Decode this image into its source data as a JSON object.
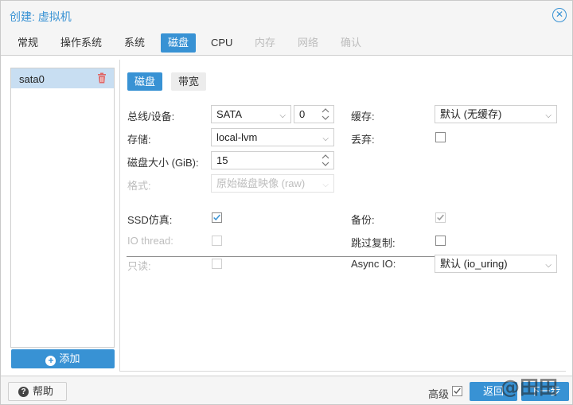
{
  "dialog": {
    "title": "创建: 虚拟机"
  },
  "tabs": [
    {
      "label": "常规",
      "state": "normal"
    },
    {
      "label": "操作系统",
      "state": "normal"
    },
    {
      "label": "系统",
      "state": "normal"
    },
    {
      "label": "磁盘",
      "state": "active"
    },
    {
      "label": "CPU",
      "state": "normal"
    },
    {
      "label": "内存",
      "state": "disabled"
    },
    {
      "label": "网络",
      "state": "disabled"
    },
    {
      "label": "确认",
      "state": "disabled"
    }
  ],
  "disk_list": {
    "items": [
      {
        "label": "sata0",
        "selected": true
      }
    ],
    "add_label": "添加"
  },
  "subtabs": [
    {
      "label": "磁盘",
      "active": true
    },
    {
      "label": "带宽",
      "active": false
    }
  ],
  "form": {
    "bus_device": {
      "label": "总线/设备:",
      "bus": "SATA",
      "device": "0"
    },
    "storage": {
      "label": "存储:",
      "value": "local-lvm"
    },
    "disk_size": {
      "label": "磁盘大小 (GiB):",
      "value": "15"
    },
    "format": {
      "label": "格式:",
      "value": "原始磁盘映像 (raw)",
      "disabled": true
    },
    "cache": {
      "label": "缓存:",
      "value": "默认 (无缓存)"
    },
    "discard": {
      "label": "丢弃:",
      "checked": false
    },
    "ssd_emulation": {
      "label": "SSD仿真:",
      "checked": true
    },
    "io_thread": {
      "label": "IO thread:",
      "checked": false,
      "disabled": true
    },
    "readonly": {
      "label": "只读:",
      "checked": false,
      "disabled": true
    },
    "backup": {
      "label": "备份:",
      "checked": true,
      "disabled": true
    },
    "skip_replication": {
      "label": "跳过复制:",
      "checked": false
    },
    "async_io": {
      "label": "Async IO:",
      "value": "默认 (io_uring)"
    }
  },
  "footer": {
    "help_label": "帮助",
    "advanced_label": "高级",
    "advanced_checked": true,
    "back_label": "返回",
    "next_label": "下一步"
  },
  "watermark": "@田田",
  "colors": {
    "accent": "#3892d4",
    "selected_row": "#c8def2",
    "delete_icon": "#e06666",
    "disabled_text": "#bdbdbd"
  },
  "icons": {
    "close": "close-circle-icon",
    "delete": "trash-icon",
    "add": "plus-circle-icon",
    "help": "question-circle-icon",
    "dropdown": "chevron-down-icon",
    "spinner": "spinner-arrows-icon",
    "check": "checkmark-icon"
  }
}
